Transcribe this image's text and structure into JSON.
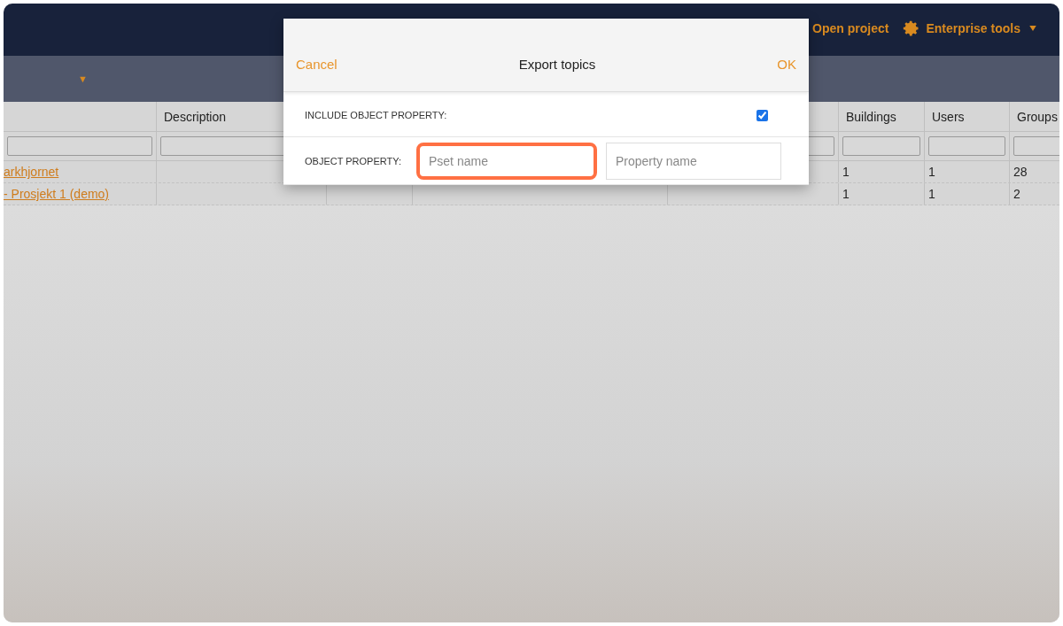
{
  "top_bar": {
    "links": [
      {
        "label": "Open project",
        "kind": "plain"
      },
      {
        "label": "Enterprise tools",
        "kind": "menu"
      }
    ]
  },
  "sub_bar": {
    "dropdown_arrow": "▼"
  },
  "table": {
    "columns": [
      "",
      "Description",
      "",
      "",
      "",
      "Buildings",
      "Users",
      "Groups"
    ],
    "rows": [
      {
        "cells": [
          "arkhjornet",
          "",
          "",
          "",
          "",
          "1",
          "1",
          "28"
        ]
      },
      {
        "cells": [
          "- Prosjekt 1 (demo)",
          "",
          "",
          "",
          "",
          "1",
          "1",
          "2"
        ]
      }
    ]
  },
  "dialog": {
    "title": "Export topics",
    "cancel": "Cancel",
    "ok": "OK",
    "include": {
      "label": "INCLUDE OBJECT PROPERTY:",
      "checked": true
    },
    "property": {
      "label": "OBJECT PROPERTY:",
      "fields": [
        {
          "placeholder": "Pset name",
          "focused": true
        },
        {
          "placeholder": "Property name",
          "focused": false
        }
      ]
    }
  }
}
